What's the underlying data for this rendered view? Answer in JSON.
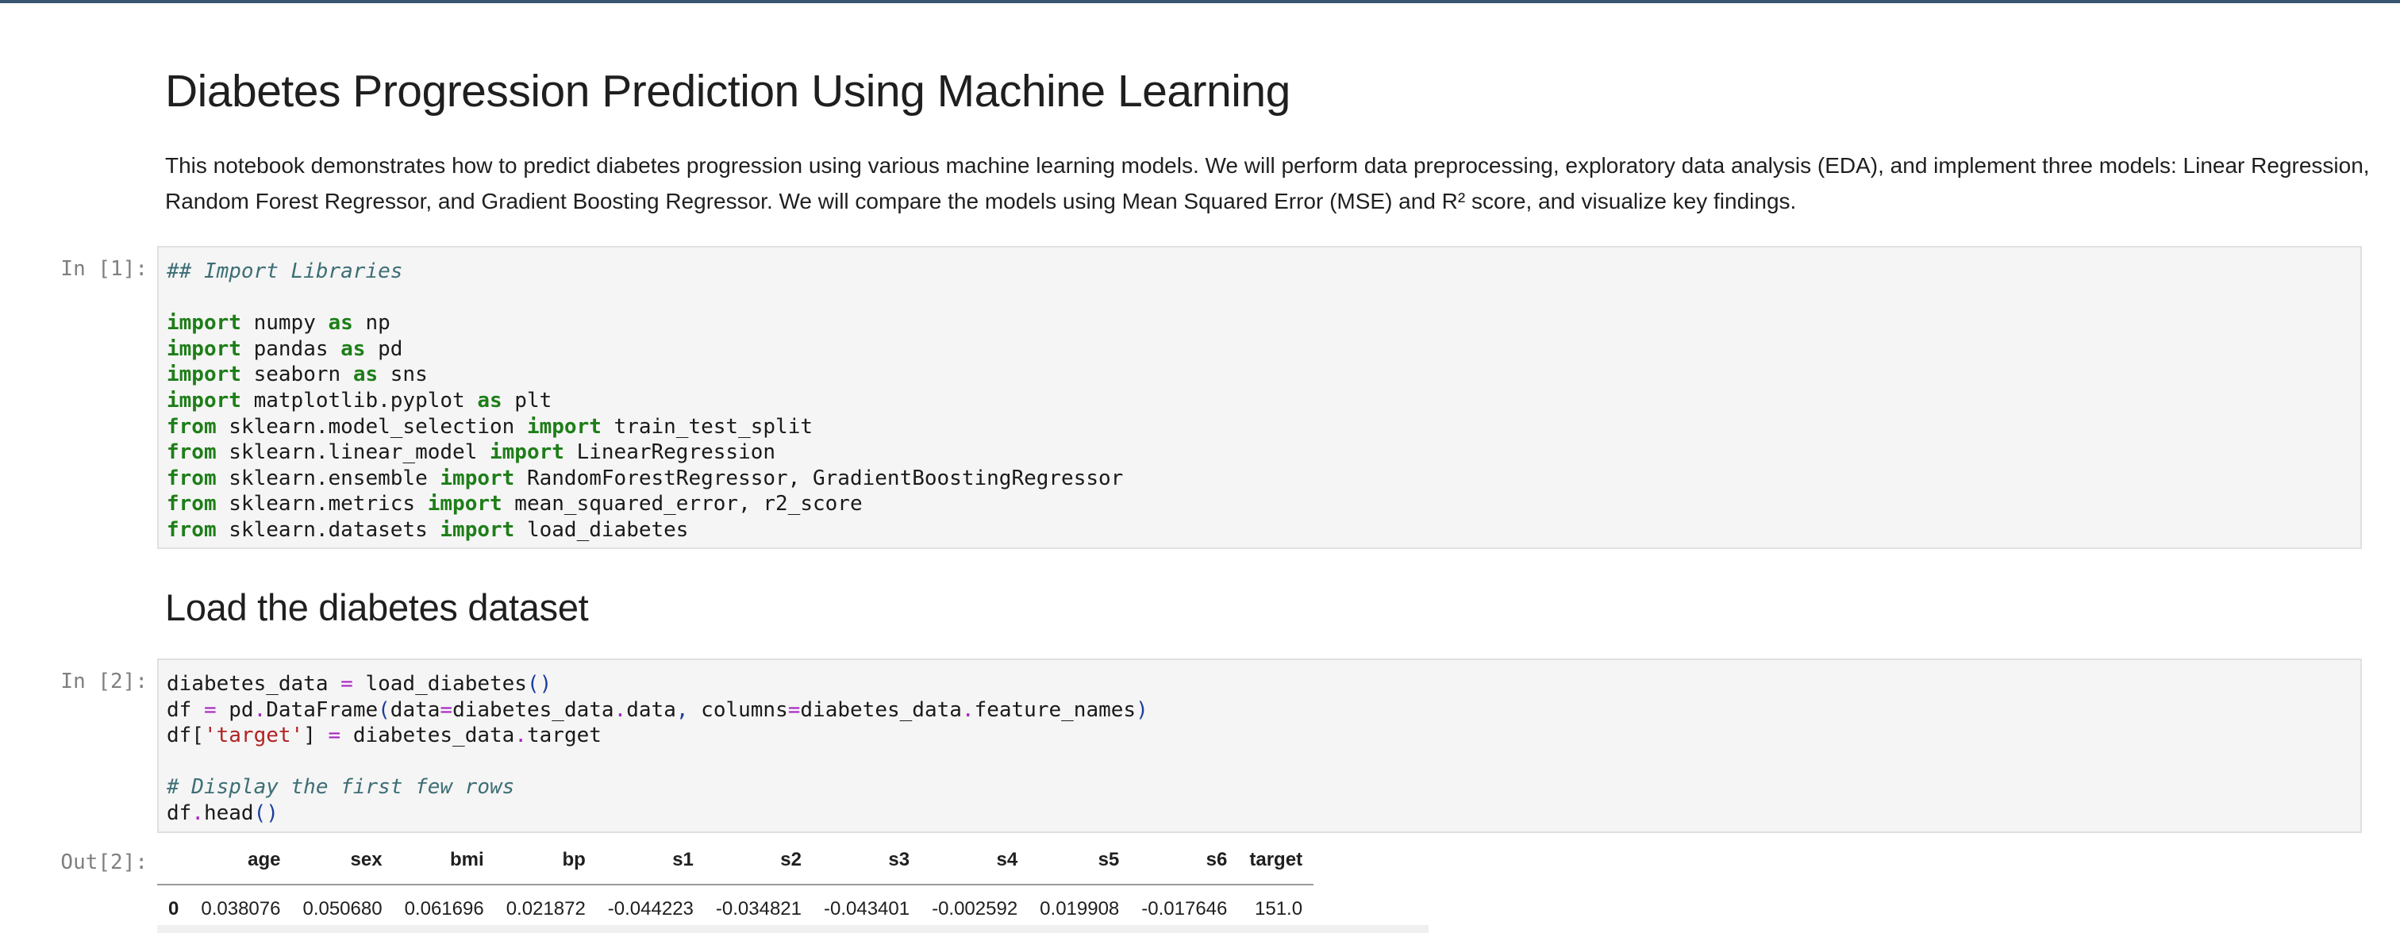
{
  "title": "Diabetes Progression Prediction Using Machine Learning",
  "intro": "This notebook demonstrates how to predict diabetes progression using various machine learning models. We will perform data preprocessing, exploratory data analysis (EDA), and implement three models: Linear Regression, Random Forest Regressor, and Gradient Boosting Regressor. We will compare the models using Mean Squared Error (MSE) and R² score, and visualize key findings.",
  "cell1": {
    "prompt": "In [1]:",
    "comment": "## Import Libraries",
    "lines": [
      {
        "kw1": "import",
        "mod": " numpy ",
        "kw2": "as",
        "rest": " np"
      },
      {
        "kw1": "import",
        "mod": " pandas ",
        "kw2": "as",
        "rest": " pd"
      },
      {
        "kw1": "import",
        "mod": " seaborn ",
        "kw2": "as",
        "rest": " sns"
      },
      {
        "kw1": "import",
        "mod": " matplotlib.pyplot ",
        "kw2": "as",
        "rest": " plt"
      },
      {
        "kw1": "from",
        "mod": " sklearn.model_selection ",
        "kw2": "import",
        "rest": " train_test_split"
      },
      {
        "kw1": "from",
        "mod": " sklearn.linear_model ",
        "kw2": "import",
        "rest": " LinearRegression"
      },
      {
        "kw1": "from",
        "mod": " sklearn.ensemble ",
        "kw2": "import",
        "rest": " RandomForestRegressor, GradientBoostingRegressor"
      },
      {
        "kw1": "from",
        "mod": " sklearn.metrics ",
        "kw2": "import",
        "rest": " mean_squared_error, r2_score"
      },
      {
        "kw1": "from",
        "mod": " sklearn.datasets ",
        "kw2": "import",
        "rest": " load_diabetes"
      }
    ]
  },
  "section_heading": "Load the diabetes dataset",
  "cell2": {
    "prompt": "In [2]:",
    "line1": "diabetes_data = load_diabetes()",
    "line2": "df = pd.DataFrame(data=diabetes_data.data, columns=diabetes_data.feature_names)",
    "line3": "df['target'] = diabetes_data.target",
    "comment": "# Display the first few rows",
    "line5": "df.head()"
  },
  "out2": {
    "prompt": "Out[2]:",
    "columns": [
      "",
      "age",
      "sex",
      "bmi",
      "bp",
      "s1",
      "s2",
      "s3",
      "s4",
      "s5",
      "s6",
      "target"
    ],
    "rows": [
      [
        "0",
        "0.038076",
        "0.050680",
        "0.061696",
        "0.021872",
        "-0.044223",
        "-0.034821",
        "-0.043401",
        "-0.002592",
        "0.019908",
        "-0.017646",
        "151.0"
      ]
    ]
  },
  "colors": {
    "keyword": "#1e7e18",
    "comment": "#3d6e75",
    "operator": "#a724c2",
    "string": "#b22222",
    "top_border": "#39556f"
  }
}
